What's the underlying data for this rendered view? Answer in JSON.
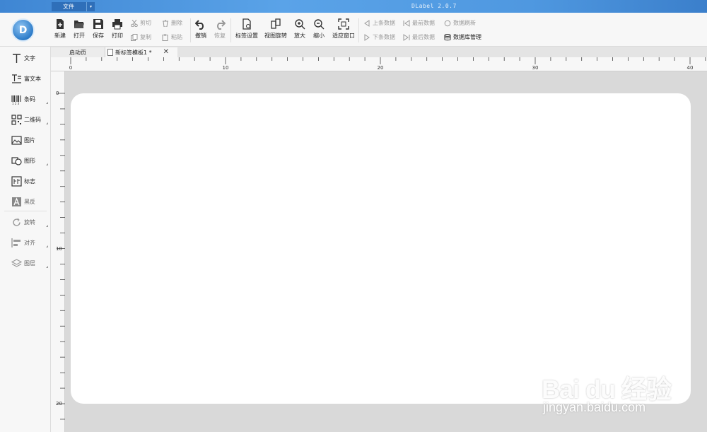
{
  "titlebar": {
    "file_menu": "文件",
    "app_title": "DLabel 2.0.7"
  },
  "toolbar": {
    "new": "新建",
    "open": "打开",
    "save": "保存",
    "print": "打印",
    "cut": "剪切",
    "copy": "复制",
    "delete": "删除",
    "paste": "粘贴",
    "undo": "撤销",
    "redo": "恢复",
    "label_settings": "标签设置",
    "view_rotate": "视图旋转",
    "zoom_in": "放大",
    "zoom_out": "缩小",
    "fit_window": "适应窗口",
    "prev_record": "上条数据",
    "next_record": "下条数据",
    "first_record": "最前数据",
    "last_record": "最后数据",
    "refresh_data": "数据刷新",
    "database_manage": "数据库管理"
  },
  "sidebar": {
    "items": [
      {
        "label": "文字",
        "icon": "text-icon"
      },
      {
        "label": "富文本",
        "icon": "rich-text-icon"
      },
      {
        "label": "条码",
        "icon": "barcode-icon"
      },
      {
        "label": "二维码",
        "icon": "qrcode-icon"
      },
      {
        "label": "图片",
        "icon": "image-icon"
      },
      {
        "label": "图形",
        "icon": "shape-icon"
      },
      {
        "label": "标志",
        "icon": "logo-icon"
      },
      {
        "label": "黑反",
        "icon": "invert-icon"
      },
      {
        "label": "旋转",
        "icon": "rotate-icon"
      },
      {
        "label": "对齐",
        "icon": "align-icon"
      },
      {
        "label": "图层",
        "icon": "layers-icon"
      }
    ]
  },
  "tabs": {
    "start": "启动页",
    "doc": "新标签模板1 *",
    "close_glyph": "✕"
  },
  "ruler": {
    "h_labels": [
      "0",
      "10",
      "20",
      "30",
      "40"
    ],
    "v_labels": [
      "0",
      "10",
      "20"
    ]
  },
  "watermark": {
    "brand": "Bai du 经验",
    "url": "jingyan.baidu.com"
  },
  "colors": {
    "titlebar": "#4f98e0",
    "workspace": "#d9d9d9",
    "canvas": "#ffffff"
  }
}
